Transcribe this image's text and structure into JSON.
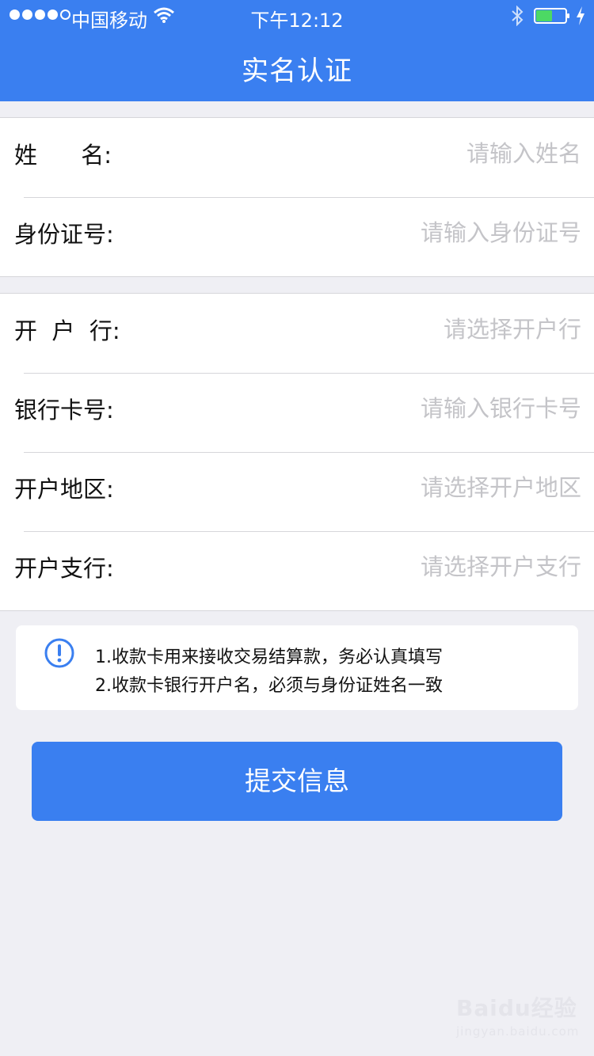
{
  "status_bar": {
    "carrier": "中国移动",
    "time": "下午12:12",
    "icons": [
      "signal-dots",
      "wifi-icon",
      "bluetooth-icon",
      "battery-icon",
      "charging-icon"
    ]
  },
  "nav": {
    "title": "实名认证"
  },
  "identity": {
    "name_label": "姓      名:",
    "name_placeholder": "请输入姓名",
    "id_label": "身份证号:",
    "id_placeholder": "请输入身份证号"
  },
  "bank": {
    "bank_label": "开  户  行:",
    "bank_placeholder": "请选择开户行",
    "card_label": "银行卡号:",
    "card_placeholder": "请输入银行卡号",
    "region_label": "开户地区:",
    "region_placeholder": "请选择开户地区",
    "branch_label": "开户支行:",
    "branch_placeholder": "请选择开户支行"
  },
  "notice": {
    "line1": "1.收款卡用来接收交易结算款，务必认真填写",
    "line2": "2.收款卡银行开户名，必须与身份证姓名一致"
  },
  "submit_label": "提交信息",
  "watermark": {
    "brand": "Baidu经验",
    "sub": "jingyan.baidu.com"
  },
  "colors": {
    "accent": "#3a7ff0",
    "background": "#efeff4",
    "placeholder": "#c4c4c8"
  }
}
